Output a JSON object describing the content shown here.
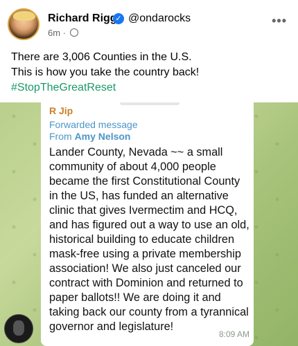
{
  "post": {
    "author": "Richard Rigg",
    "handle": "@ondarocks",
    "time": "6m",
    "separator": "·",
    "text_line1": "There are 3,006 Counties in the U.S.",
    "text_line2": "This is how you take the country back!",
    "hashtag": "#StopTheGreatReset",
    "more_label": "•••",
    "verified_glyph": "✓"
  },
  "forward": {
    "sender": "R Jip",
    "label": "Forwarded message",
    "from_prefix": "From",
    "from_name": "Amy Nelson",
    "message": "Lander County, Nevada ~~ a small community of about 4,000 people became the first Constitutional County in the US, has funded an alternative clinic that gives Ivermectim and HCQ, and has figured out a way to use an old, historical building to educate children mask-free using a private membership association! We also just canceled our contract with Dominion and returned to paper ballots!! We are doing it and taking back our county from a tyrannical governor and legislature!",
    "time": "8:09 AM"
  },
  "colors": {
    "hashtag": "#1a9a6a",
    "sender": "#c9802a",
    "forward": "#4a96c9",
    "verified": "#1877f2"
  }
}
